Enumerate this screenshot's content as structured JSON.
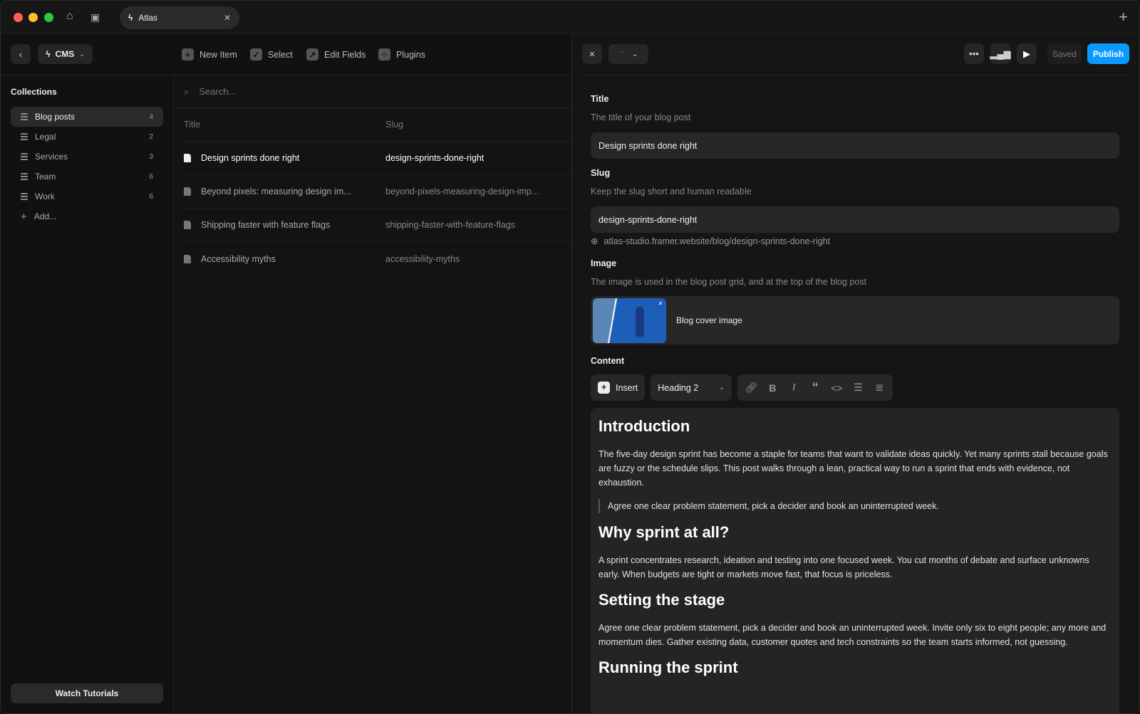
{
  "window": {
    "tab_title": "Atlas"
  },
  "toolbar": {
    "cms_label": "CMS",
    "new_item": "New Item",
    "select": "Select",
    "edit_fields": "Edit Fields",
    "plugins": "Plugins"
  },
  "sidebar": {
    "heading": "Collections",
    "items": [
      {
        "label": "Blog posts",
        "count": "4"
      },
      {
        "label": "Legal",
        "count": "2"
      },
      {
        "label": "Services",
        "count": "3"
      },
      {
        "label": "Team",
        "count": "6"
      },
      {
        "label": "Work",
        "count": "6"
      }
    ],
    "add_label": "Add...",
    "watch_tutorials": "Watch Tutorials"
  },
  "list": {
    "search_placeholder": "Search...",
    "columns": {
      "title": "Title",
      "slug": "Slug"
    },
    "rows": [
      {
        "title": "Design sprints done right",
        "slug": "design-sprints-done-right"
      },
      {
        "title": "Beyond pixels: measuring design im...",
        "slug": "beyond-pixels-measuring-design-imp..."
      },
      {
        "title": "Shipping faster with feature flags",
        "slug": "shipping-faster-with-feature-flags"
      },
      {
        "title": "Accessibility myths",
        "slug": "accessibility-myths"
      }
    ]
  },
  "editor_header": {
    "saved": "Saved",
    "publish": "Publish",
    "accent": "#0a99ff"
  },
  "form": {
    "title_label": "Title",
    "title_hint": "The title of your blog post",
    "title_value": "Design sprints done right",
    "slug_label": "Slug",
    "slug_hint": "Keep the slug short and human readable",
    "slug_value": "design-sprints-done-right",
    "url": "atlas-studio.framer.website/blog/design-sprints-done-right",
    "image_label": "Image",
    "image_hint": "The image is used in the blog post grid, and at the top of the blog post",
    "image_name": "Blog cover image",
    "content_label": "Content",
    "insert": "Insert",
    "block_type": "Heading 2"
  },
  "content": {
    "h1": "Introduction",
    "p1": "The five-day design sprint has become a staple for teams that want to validate ideas quickly. Yet many sprints stall because goals are fuzzy or the schedule slips. This post walks through a lean, practical way to run a sprint that ends with evidence, not exhaustion.",
    "quote": "Agree one clear problem statement, pick a decider and book an uninterrupted week.",
    "h2": "Why sprint at all?",
    "p2": "A sprint concentrates research, ideation and testing into one focused week. You cut months of debate and surface unknowns early. When budgets are tight or markets move fast, that focus is priceless.",
    "h3": "Setting the stage",
    "p3": "Agree one clear problem statement, pick a decider and book an uninterrupted week. Invite only six to eight people; any more and momentum dies. Gather existing data, customer quotes and tech constraints so the team starts informed, not guessing.",
    "h4": "Running the sprint"
  }
}
